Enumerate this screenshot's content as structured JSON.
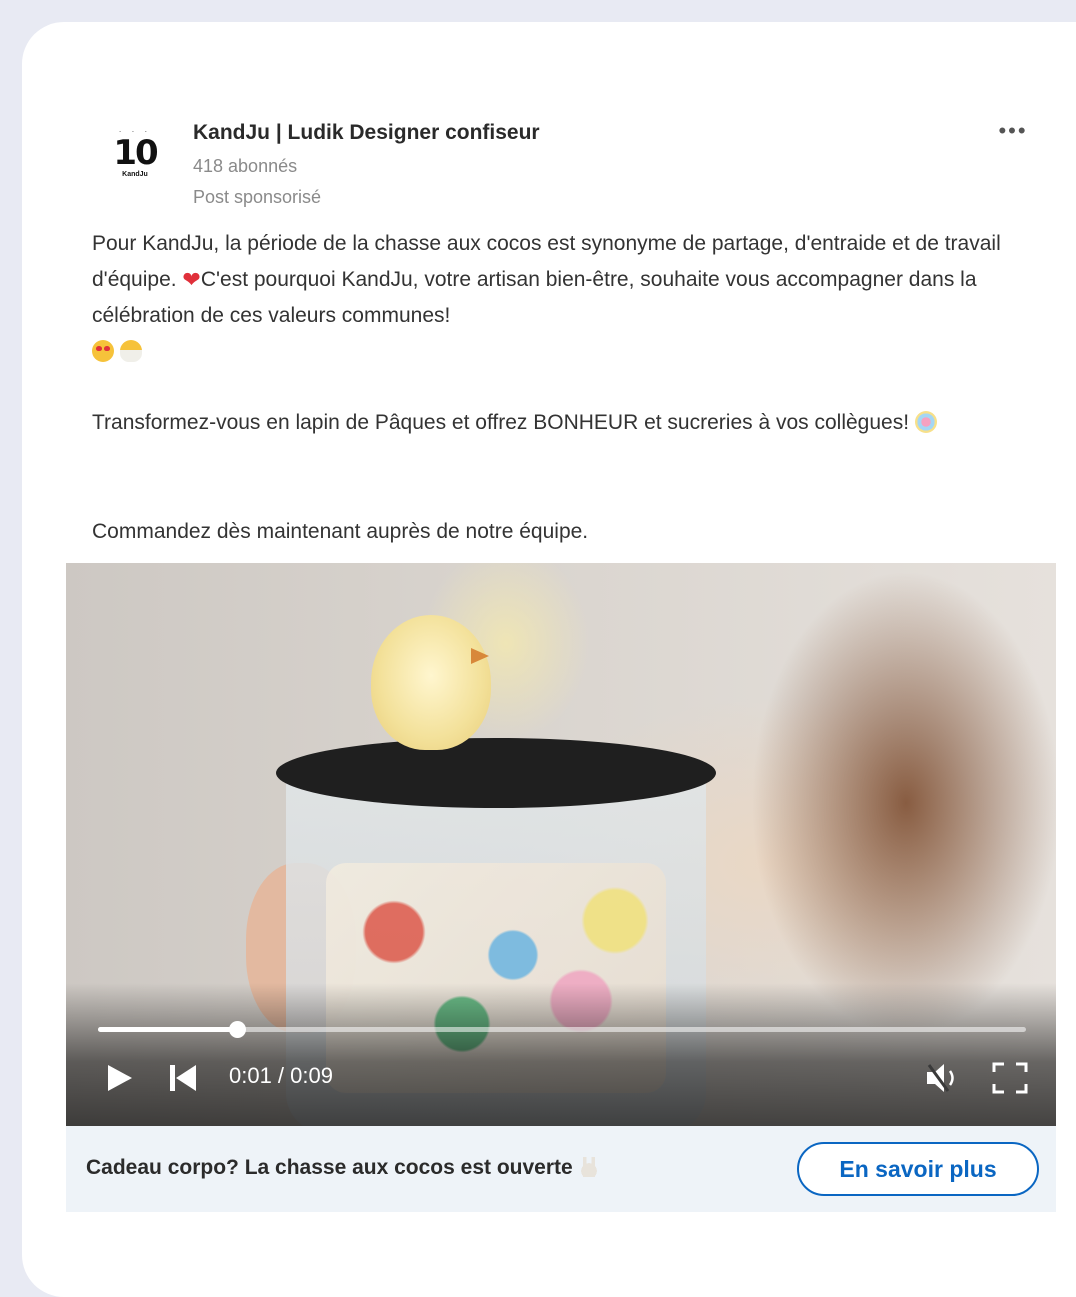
{
  "post": {
    "author": {
      "name": "KandJu | Ludik Designer confiseur",
      "followers": "418 abonnés",
      "label": "Post sponsorisé",
      "logo_text": "10",
      "logo_subtext": "KandJu"
    },
    "more_label": "•••",
    "body": {
      "p1_a": "Pour KandJu, la période de la chasse aux cocos est synonyme de partage, d'entraide et de travail d'équipe. ",
      "p1_b": "C'est pourquoi KandJu, votre artisan bien-être, souhaite vous accompagner dans la célébration de ces valeurs communes!",
      "p2": "Transformez-vous en lapin de Pâques et offrez BONHEUR et sucreries à vos collègues! ",
      "p3": "Commandez dès maintenant auprès de notre équipe."
    },
    "emojis": [
      "heart-icon",
      "smiling-face-heart-eyes-icon",
      "hatching-chick-icon",
      "lollipop-icon",
      "rabbit-icon"
    ],
    "video": {
      "time": "0:01 / 0:09",
      "progress": 0.15,
      "muted": true
    },
    "cta": {
      "headline": "Cadeau corpo? La chasse aux cocos est ouverte",
      "button": "En savoir plus"
    }
  },
  "colors": {
    "background": "#e8eaf3",
    "card": "#ffffff",
    "cta_bar": "#eef3f8",
    "accent": "#0a66c2"
  }
}
